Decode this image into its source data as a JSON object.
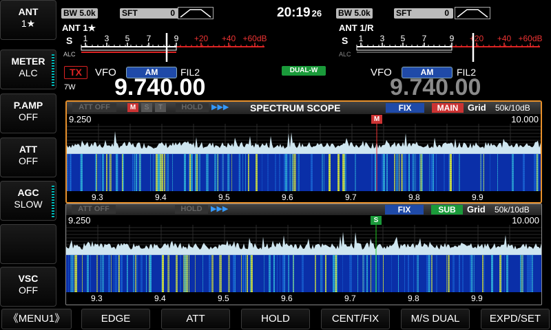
{
  "left_keys": [
    {
      "title": "ANT",
      "value": "1★"
    },
    {
      "title": "METER",
      "value": "ALC"
    },
    {
      "title": "P.AMP",
      "value": "OFF"
    },
    {
      "title": "ATT",
      "value": "OFF"
    },
    {
      "title": "AGC",
      "value": "SLOW"
    },
    {
      "title": "",
      "value": ""
    },
    {
      "title": "VSC",
      "value": "OFF"
    }
  ],
  "bottom_keys": [
    "《MENU1》",
    "EDGE",
    "ATT",
    "HOLD",
    "CENT/FIX",
    "M/S DUAL",
    "EXPD/SET"
  ],
  "clock": {
    "time": "20:19",
    "seconds": "26"
  },
  "main": {
    "bw_label": "BW",
    "bw_value": "5.0k",
    "sft_label": "SFT",
    "sft_value": "0",
    "ant": "ANT 1★",
    "meter_scale": [
      "1",
      "3",
      "5",
      "7",
      "9",
      "+20",
      "+40",
      "+60dB"
    ],
    "s_label": "S",
    "alc_label": "ALC",
    "tx": "TX",
    "power": "7W",
    "vfo": "VFO",
    "mode": "AM",
    "filter": "FIL2",
    "frequency": "9.740.00"
  },
  "dual_watch": "DUAL-W",
  "sub": {
    "bw_label": "BW",
    "bw_value": "5.0k",
    "sft_label": "SFT",
    "sft_value": "0",
    "ant": "ANT 1/R",
    "meter_scale": [
      "1",
      "3",
      "5",
      "7",
      "9",
      "+20",
      "+40",
      "+60dB"
    ],
    "s_label": "S",
    "alc_label": "ALC",
    "vfo": "VFO",
    "mode": "AM",
    "filter": "FIL2",
    "frequency": "9.740.00"
  },
  "scope_main": {
    "att": "ATT OFF",
    "m": "M",
    "s": "S",
    "t": "T",
    "hold": "HOLD",
    "arrows": "▶▶▶",
    "title": "SPECTRUM  SCOPE",
    "fix": "FIX",
    "band": "MAIN",
    "grid": "Grid",
    "span": "50k/10dB",
    "start": "9.250",
    "end": "10.000",
    "marker": "M",
    "ticks": [
      "9.3",
      "9.4",
      "9.5",
      "9.6",
      "9.7",
      "9.8",
      "9.9"
    ]
  },
  "scope_sub": {
    "att": "ATT OFF",
    "hold": "HOLD",
    "arrows": "▶▶▶",
    "fix": "FIX",
    "band": "SUB",
    "grid": "Grid",
    "span": "50k/10dB",
    "start": "9.250",
    "end": "10.000",
    "marker": "S",
    "ticks": [
      "9.3",
      "9.4",
      "9.5",
      "9.6",
      "9.7",
      "9.8",
      "9.9"
    ]
  },
  "colors": {
    "accent_orange": "#e8902a",
    "scope_blue": "#1f4aa8",
    "red": "#d22",
    "green": "#1a9a3a",
    "waterfall": "#0a2fa8"
  }
}
